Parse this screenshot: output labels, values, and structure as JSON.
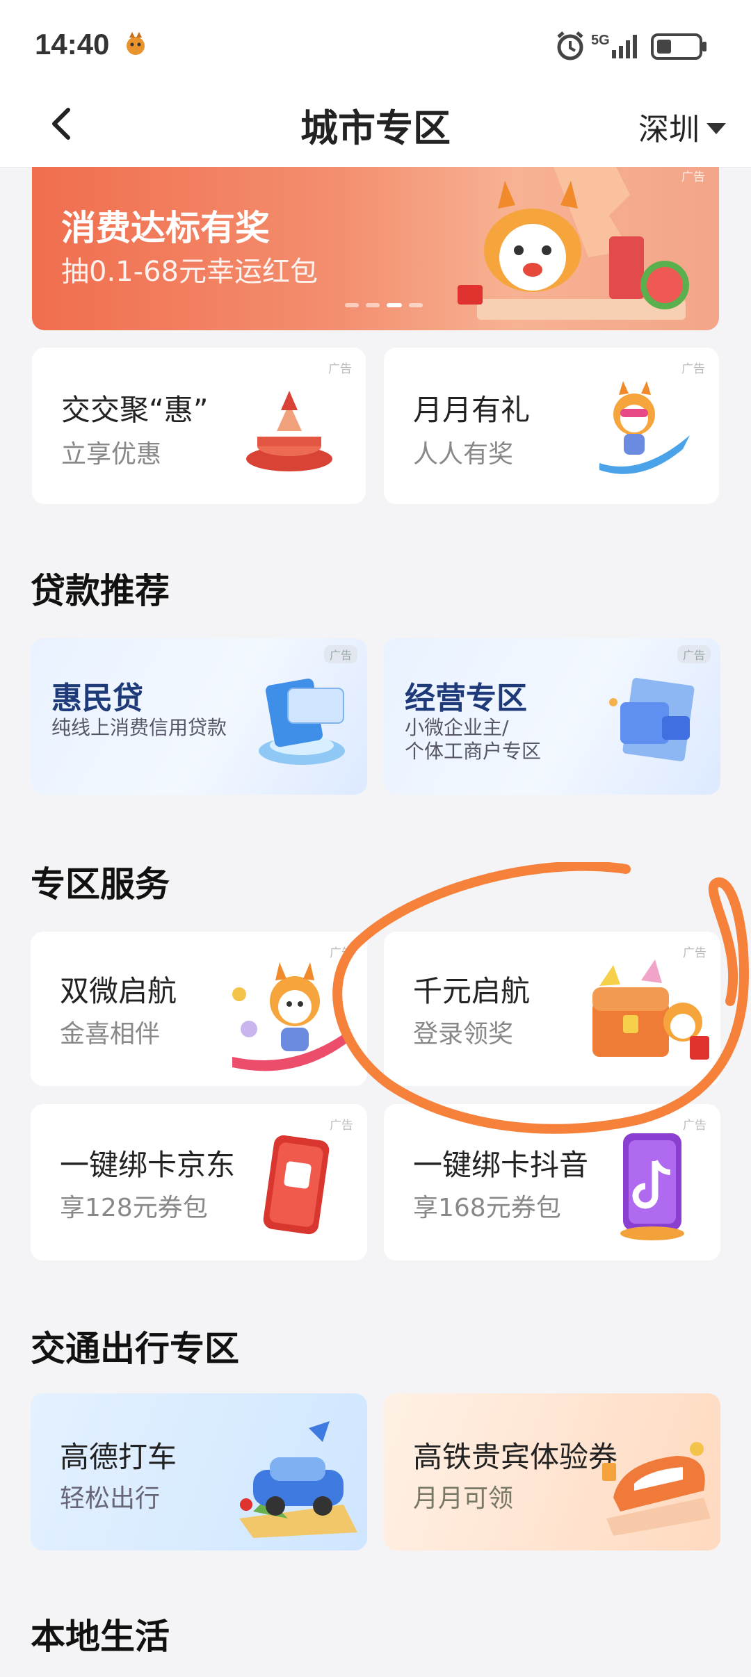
{
  "status": {
    "time": "14:40",
    "network": "5G"
  },
  "nav": {
    "title": "城市专区",
    "city": "深圳"
  },
  "banner": {
    "title": "消费达标有奖",
    "subtitle": "抽0.1-68元幸运红包",
    "ad": "广告",
    "page_index": 3,
    "page_count": 4
  },
  "promo_cards": [
    {
      "title": "交交聚“惠”",
      "subtitle": "立享优惠",
      "ad": "广告",
      "icon": "gift-podium-icon"
    },
    {
      "title": "月月有礼",
      "subtitle": "人人有奖",
      "ad": "广告",
      "icon": "mascot-surfing-icon"
    }
  ],
  "loan_section": {
    "title": "贷款推荐",
    "items": [
      {
        "title": "惠民贷",
        "subtitle": "纯线上消费信用贷款",
        "ad": "广告",
        "icon": "cards-stack-icon"
      },
      {
        "title": "经营专区",
        "subtitle_line1": "小微企业主/",
        "subtitle_line2": "个体工商户专区",
        "ad": "广告",
        "icon": "document-folder-icon"
      }
    ]
  },
  "service_section": {
    "title": "专区服务",
    "items": [
      {
        "title": "双微启航",
        "subtitle": "金喜相伴",
        "ad": "广告",
        "icon": "mascot-coins-icon"
      },
      {
        "title": "千元启航",
        "subtitle": "登录领奖",
        "ad": "广告",
        "icon": "treasure-chest-icon"
      },
      {
        "title": "一键绑卡京东",
        "subtitle": "享128元券包",
        "ad": "广告",
        "icon": "phone-jd-icon"
      },
      {
        "title": "一键绑卡抖音",
        "subtitle": "享168元券包",
        "ad": "广告",
        "icon": "phone-tiktok-icon"
      }
    ]
  },
  "transport_section": {
    "title": "交通出行专区",
    "items": [
      {
        "title": "高德打车",
        "subtitle": "轻松出行",
        "icon": "car-map-icon"
      },
      {
        "title": "高铁贵宾体验券",
        "subtitle": "月月可领",
        "icon": "train-icon"
      }
    ]
  },
  "local_section": {
    "title": "本地生活"
  },
  "colors": {
    "banner": "#f06e4e",
    "loan_title": "#1e3a78",
    "annotation": "#f5813b"
  }
}
